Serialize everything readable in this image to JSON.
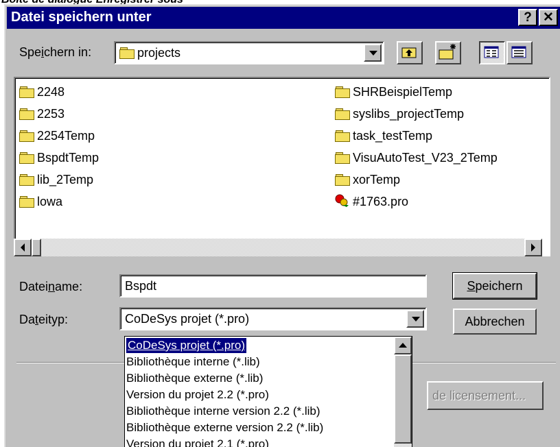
{
  "caption": "Boîte de dialogue Enregistrer sous",
  "window": {
    "title": "Datei speichern unter",
    "help_button": "?",
    "close_button": "✕"
  },
  "save_in": {
    "label_pre": "Spe",
    "label_u": "i",
    "label_post": "chern in:",
    "value": "projects"
  },
  "files": {
    "left": [
      "2248",
      "2253",
      "2254Temp",
      "BspdtTemp",
      "lib_2Temp",
      "lowa"
    ],
    "right": [
      "SHRBeispielTemp",
      "syslibs_projectTemp",
      "task_testTemp",
      "VisuAutoTest_V23_2Temp",
      "xorTemp",
      "#1763.pro"
    ],
    "right_icons": [
      "folder",
      "folder",
      "folder",
      "folder",
      "folder",
      "codesys-project"
    ]
  },
  "filename": {
    "label_pre": "Datei",
    "label_u": "n",
    "label_post": "ame:",
    "value": "Bspdt"
  },
  "filetype": {
    "label_pre": "Da",
    "label_u": "t",
    "label_post": "eityp:",
    "value": "CoDeSys projet (*.pro)"
  },
  "buttons": {
    "save_u": "S",
    "save_rest": "peichern",
    "cancel": "Abbrechen",
    "license": "de licensement..."
  },
  "dropdown_options": [
    "CoDeSys projet (*.pro)",
    "Bibliothèque interne (*.lib)",
    "Bibliothèque externe (*.lib)",
    "Version du projet 2.2 (*.pro)",
    "Bibliothèque interne version 2.2 (*.lib)",
    "Bibliothèque externe version 2.2 (*.lib)",
    "Version du projet 2.1 (*.pro)"
  ],
  "colors": {
    "titlebar": "#000080",
    "face": "#c0c0c0",
    "selection": "#000080"
  }
}
